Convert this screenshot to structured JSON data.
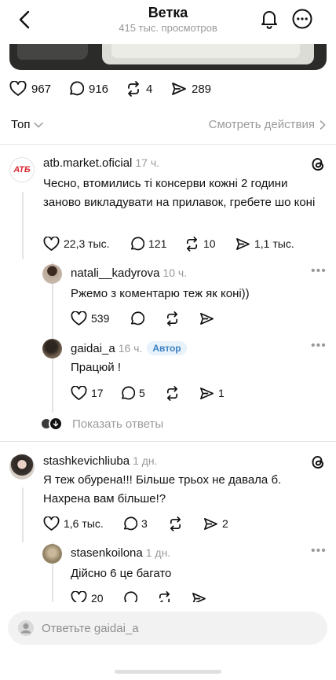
{
  "header": {
    "title": "Ветка",
    "subtitle": "415 тыс. просмотров"
  },
  "post_stats": {
    "likes": "967",
    "comments": "916",
    "reposts": "4",
    "shares": "289"
  },
  "sort": {
    "label": "Топ",
    "activity_link": "Смотреть действия"
  },
  "comments": [
    {
      "username": "atb.market.oficial",
      "time": "17 ч.",
      "avatar_text": "АТБ",
      "text": "Чесно, втомились ті консерви кожні 2 години заново викладувати на прилавок, гребете шо коні",
      "likes": "22,3 тыс.",
      "replies": "121",
      "reposts": "10",
      "shares": "1,1 тыс."
    },
    {
      "username": "natali__kadyrova",
      "time": "10 ч.",
      "text": "Ржемо з коментарю теж як коні))",
      "likes": "539"
    },
    {
      "username": "gaidai_a",
      "time": "16 ч.",
      "badge": "Автор",
      "text": "Працюй !",
      "likes": "17",
      "replies": "5",
      "shares": "1"
    },
    {
      "show_replies": "Показать ответы"
    },
    {
      "username": "stashkevichliuba",
      "time": "1 дн.",
      "text": "Я теж обурена!!! Більше трьох не давала б. Нахрена вам більше!?",
      "likes": "1,6 тыс.",
      "replies": "3",
      "shares": "2"
    },
    {
      "username": "stasenkoilona",
      "time": "1 дн.",
      "text": "Дійсно 6 це багато",
      "likes": "20"
    }
  ],
  "reply_bar": {
    "placeholder": "Ответьте gaidai_a"
  },
  "colors": {
    "muted": "#9a9a9a",
    "badge_text": "#3b82c4",
    "badge_bg": "#e8f2fb",
    "atb_red": "#d7282f"
  },
  "icons": [
    "back-icon",
    "bell-icon",
    "more-icon",
    "heart-icon",
    "comment-icon",
    "repost-icon",
    "share-icon",
    "chevron-down-icon",
    "chevron-right-icon",
    "threads-icon",
    "ellipsis-icon",
    "user-icon"
  ]
}
